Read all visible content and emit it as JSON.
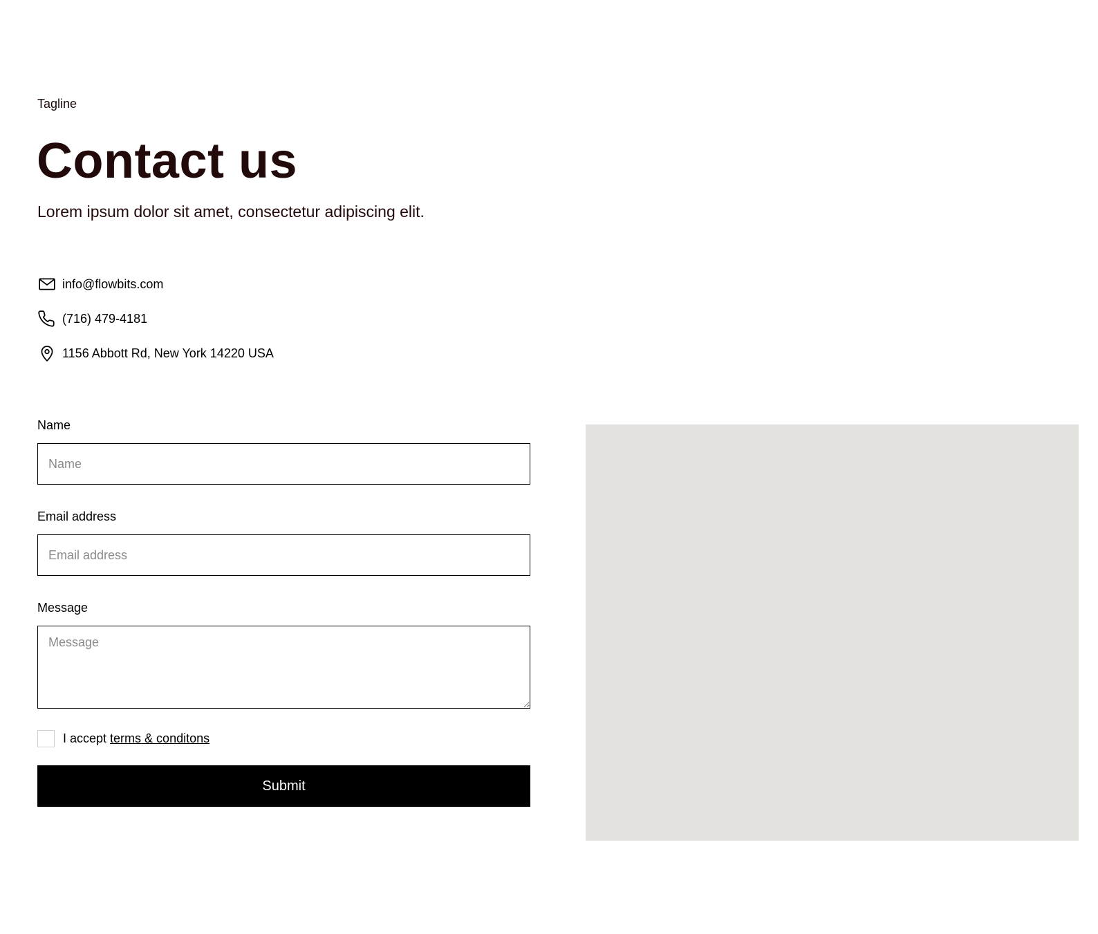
{
  "header": {
    "tagline": "Tagline",
    "title": "Contact us",
    "subtitle": "Lorem ipsum dolor sit amet, consectetur adipiscing elit."
  },
  "contact": {
    "email": {
      "icon": "mail-icon",
      "text": "info@flowbits.com"
    },
    "phone": {
      "icon": "phone-icon",
      "text": "(716) 479-4181"
    },
    "address": {
      "icon": "map-pin-icon",
      "text": "1156 Abbott Rd, New York 14220 USA"
    }
  },
  "form": {
    "name": {
      "label": "Name",
      "placeholder": "Name",
      "value": ""
    },
    "email": {
      "label": "Email address",
      "placeholder": "Email address",
      "value": ""
    },
    "message": {
      "label": "Message",
      "placeholder": "Message",
      "value": ""
    },
    "terms": {
      "prefix": "I accept",
      "link": "terms & conditons",
      "checked": false
    },
    "submit_label": "Submit"
  },
  "colors": {
    "heading": "#220a0a",
    "button_bg": "#000000",
    "button_text": "#ffffff",
    "image_placeholder": "#e3e2de"
  }
}
